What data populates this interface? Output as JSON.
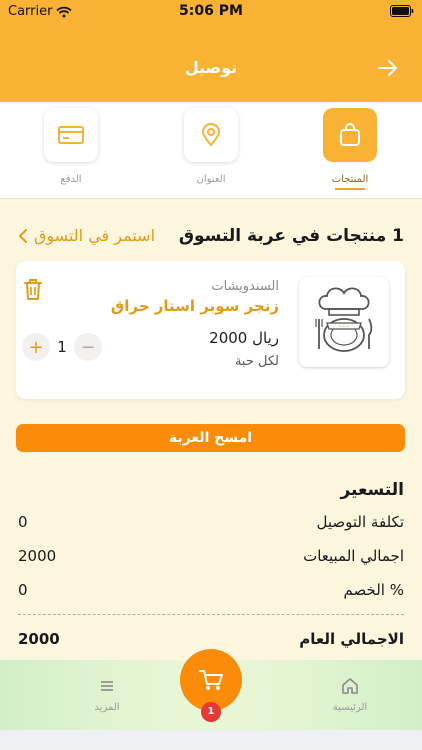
{
  "status_bar": {
    "carrier": "Carrier",
    "time": "5:06 PM"
  },
  "header": {
    "title": "توصيل"
  },
  "tabs": [
    {
      "label": "المنتجات",
      "icon": "shopping-bag-icon",
      "active": true
    },
    {
      "label": "العنوان",
      "icon": "location-pin-icon",
      "active": false
    },
    {
      "label": "الدفع",
      "icon": "credit-card-icon",
      "active": false
    }
  ],
  "cart": {
    "count_label": "1 منتجات في عربة التسوق",
    "continue_label": "استمر في التسوق",
    "items": [
      {
        "category": "السندويشات",
        "name": "زنجر سوبر استار حراق",
        "price": "2000 ريال",
        "unit": "لكل حبة",
        "quantity": "1"
      }
    ],
    "clear_label": "امسح العربة"
  },
  "pricing": {
    "title": "التسعير",
    "rows": [
      {
        "label": "تكلفة التوصيل",
        "value": "0"
      },
      {
        "label": "اجمالي المبيعات",
        "value": "2000"
      },
      {
        "label": "الخصم %",
        "value": "0"
      }
    ],
    "total": {
      "label": "الاجمالي العام",
      "value": "2000"
    }
  },
  "bottom_nav": {
    "home_label": "الرئيسية",
    "more_label": "المزيد",
    "cart_badge": "1"
  },
  "colors": {
    "brand": "#f9b233",
    "accent": "#fb8c0a",
    "badge": "#e53935"
  }
}
